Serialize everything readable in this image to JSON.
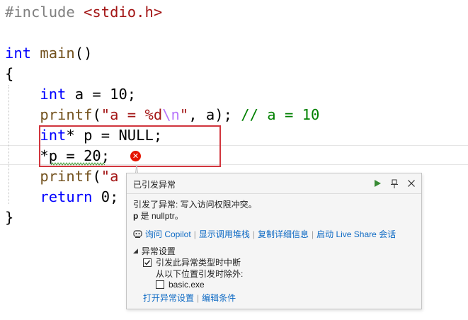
{
  "editor": {
    "line1_pp": "#include",
    "line1_inc": "<stdio.h>",
    "line3_kw": "int",
    "line3_fn": "main",
    "line3_rest": "()",
    "line4": "{",
    "line5_kw": "int",
    "line5_rest": " a = 10;",
    "line6_fn": "printf",
    "line6_open": "(",
    "line6_str1": "\"a = %d",
    "line6_esc": "\\n",
    "line6_str2": "\"",
    "line6_rest": ", a); ",
    "line6_cm": "// a = 10",
    "line7_kw": "int",
    "line7_rest": "* p = NULL;",
    "line8": "*p = 20;",
    "line9_fn": "printf",
    "line9_open": "(",
    "line9_str1": "\"a",
    "line10_kw": "return",
    "line10_rest": " 0;",
    "line11": "}"
  },
  "exception": {
    "title": "已引发异常",
    "message_line1": "引发了异常: 写入访问权限冲突。",
    "message_var": "p",
    "message_line2_rest": " 是 nullptr。",
    "actions": {
      "ask_copilot": "询问 Copilot",
      "show_call_stack": "显示调用堆栈",
      "copy_details": "复制详细信息",
      "live_share": "启动 Live Share 会话"
    },
    "settings_header": "异常设置",
    "break_on_type": "引发此异常类型时中断",
    "except_from": "从以下位置引发时除外:",
    "module": "basic.exe",
    "open_settings": "打开异常设置",
    "edit_conditions": "编辑条件",
    "colors": {
      "link": "#0e6ac4",
      "error": "#e51400",
      "highlight": "#d1353d"
    }
  }
}
